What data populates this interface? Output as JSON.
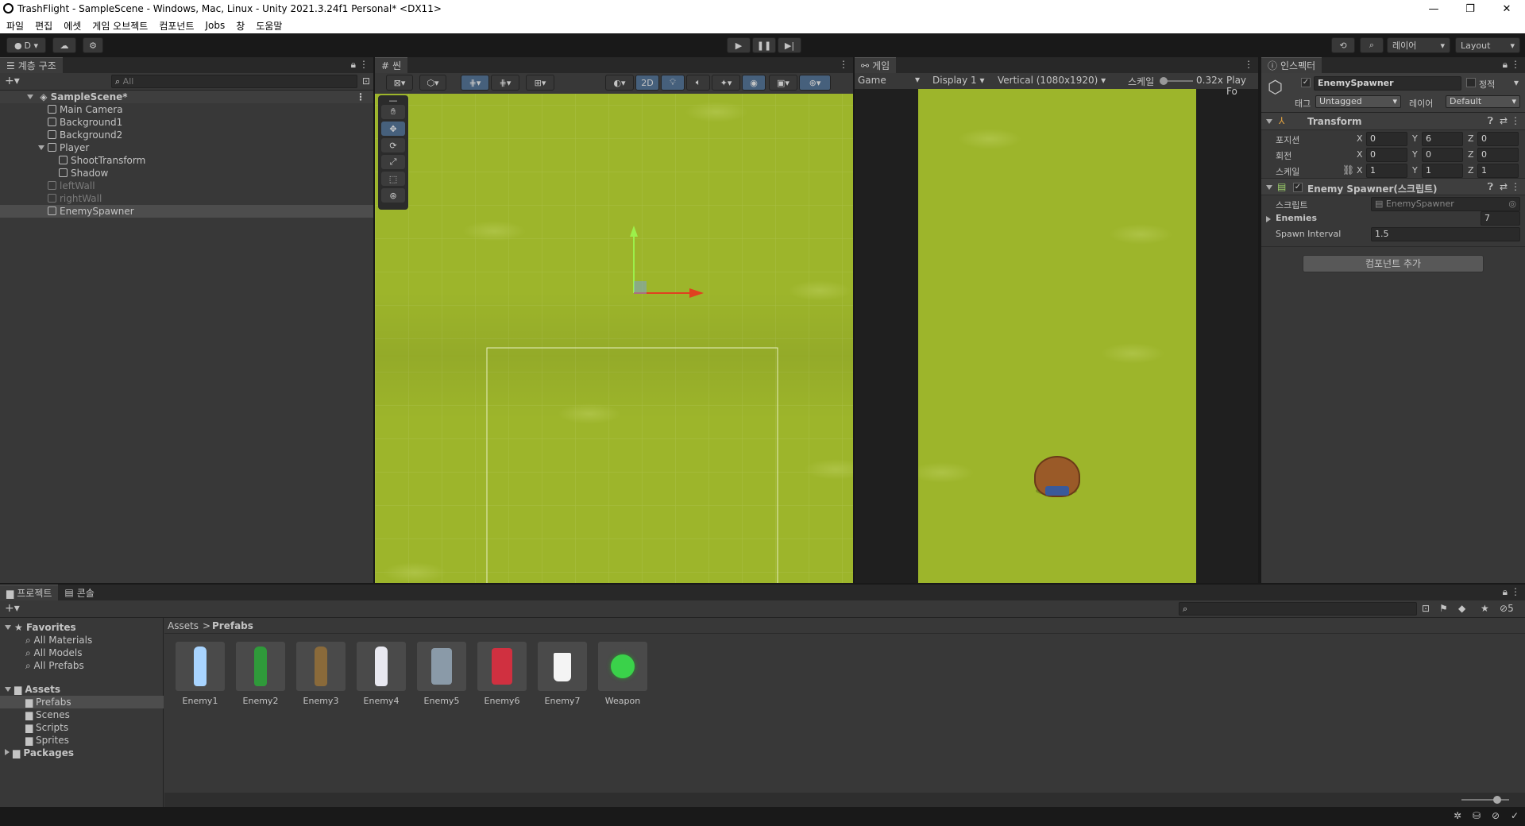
{
  "window": {
    "title": "TrashFlight - SampleScene - Windows, Mac, Linux - Unity 2021.3.24f1 Personal* <DX11>",
    "minimize": "—",
    "maximize": "❐",
    "close": "✕"
  },
  "menu": [
    "파일",
    "편집",
    "에셋",
    "게임 오브젝트",
    "컴포넌트",
    "Jobs",
    "창",
    "도움말"
  ],
  "toolbar": {
    "account": "D ▾",
    "layers": "레이어",
    "layout": "Layout"
  },
  "hierarchy": {
    "tab": "계층 구조",
    "search_placeholder": "All",
    "scene": "SampleScene*",
    "items": [
      {
        "label": "Main Camera",
        "indent": 1,
        "dim": false
      },
      {
        "label": "Background1",
        "indent": 1,
        "dim": false
      },
      {
        "label": "Background2",
        "indent": 1,
        "dim": false
      },
      {
        "label": "Player",
        "indent": 1,
        "dim": false
      },
      {
        "label": "ShootTransform",
        "indent": 2,
        "dim": false
      },
      {
        "label": "Shadow",
        "indent": 2,
        "dim": false
      },
      {
        "label": "leftWall",
        "indent": 1,
        "dim": true
      },
      {
        "label": "rightWall",
        "indent": 1,
        "dim": true
      },
      {
        "label": "EnemySpawner",
        "indent": 1,
        "dim": false
      }
    ]
  },
  "scene": {
    "tab": "씬",
    "mode_2d": "2D"
  },
  "game": {
    "tab": "게임",
    "view": "Game",
    "display": "Display 1",
    "resolution": "Vertical (1080x1920)",
    "scale_label": "스케일",
    "scale_value": "0.32x",
    "play_focus": "Play Fo"
  },
  "inspector": {
    "tab": "인스펙터",
    "object_name": "EnemySpawner",
    "static_label": "정적",
    "tag_label": "태그",
    "tag_value": "Untagged",
    "layer_label": "레이어",
    "layer_value": "Default",
    "transform": {
      "title": "Transform",
      "position_label": "포지션",
      "rotation_label": "회전",
      "scale_label": "스케일",
      "position": {
        "x": "0",
        "y": "6",
        "z": "0"
      },
      "rotation": {
        "x": "0",
        "y": "0",
        "z": "0"
      },
      "scale": {
        "x": "1",
        "y": "1",
        "z": "1"
      },
      "x": "X",
      "y": "Y",
      "z": "Z"
    },
    "script_component": {
      "title": "Enemy Spawner(스크립트)",
      "script_label": "스크립트",
      "script_value": "EnemySpawner",
      "enemies_label": "Enemies",
      "enemies_value": "7",
      "interval_label": "Spawn Interval",
      "interval_value": "1.5"
    },
    "add_component": "컴포넌트 추가"
  },
  "project": {
    "tab_project": "프로젝트",
    "tab_console": "콘솔",
    "favorites": "Favorites",
    "favorite_items": [
      "All Materials",
      "All Models",
      "All Prefabs"
    ],
    "assets": "Assets",
    "asset_folders": [
      "Prefabs",
      "Scenes",
      "Scripts",
      "Sprites"
    ],
    "packages": "Packages",
    "breadcrumb_root": "Assets",
    "breadcrumb_sep": ">",
    "breadcrumb_current": "Prefabs",
    "hidden_count": "5",
    "prefabs": [
      {
        "name": "Enemy1",
        "color": "#a8d4ff"
      },
      {
        "name": "Enemy2",
        "color": "#2f9a3a"
      },
      {
        "name": "Enemy3",
        "color": "#8a6a3a"
      },
      {
        "name": "Enemy4",
        "color": "#e8e8f0"
      },
      {
        "name": "Enemy5",
        "color": "#8a9aa8"
      },
      {
        "name": "Enemy6",
        "color": "#d03040"
      },
      {
        "name": "Enemy7",
        "color": "#f4f4f4"
      },
      {
        "name": "Weapon",
        "color": "#3ad24a"
      }
    ]
  }
}
